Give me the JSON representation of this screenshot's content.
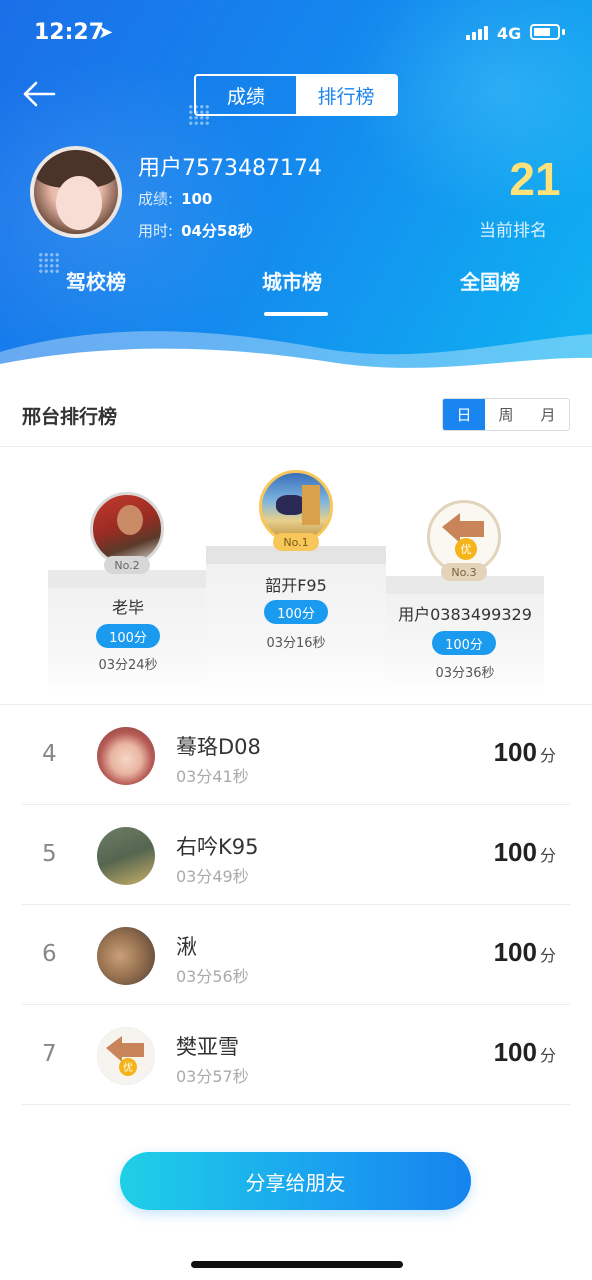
{
  "status_bar": {
    "time": "12:27",
    "network": "4G"
  },
  "segment": {
    "left_label": "成绩",
    "right_label": "排行榜",
    "active": "排行榜"
  },
  "user": {
    "name": "用户7573487174",
    "score_label": "成绩:",
    "score_value": "100",
    "time_label": "用时:",
    "time_value": "04分58秒"
  },
  "current_rank": {
    "value": "21",
    "label": "当前排名"
  },
  "tabs": [
    {
      "label": "驾校榜"
    },
    {
      "label": "城市榜"
    },
    {
      "label": "全国榜"
    }
  ],
  "active_tab": "城市榜",
  "section": {
    "title": "邢台排行榜"
  },
  "period": {
    "options": [
      "日",
      "周",
      "月"
    ],
    "active": "日"
  },
  "podium": [
    {
      "badge": "No.1",
      "name": "韶开F95",
      "score": "100分",
      "time": "03分16秒"
    },
    {
      "badge": "No.2",
      "name": "老毕",
      "score": "100分",
      "time": "03分24秒"
    },
    {
      "badge": "No.3",
      "name": "用户0383499329",
      "score": "100分",
      "time": "03分36秒",
      "avatar_text": "优"
    }
  ],
  "list": [
    {
      "rank": "4",
      "name": "蓦珞D08",
      "time": "03分41秒",
      "score": "100",
      "unit": "分"
    },
    {
      "rank": "5",
      "name": "右吟K95",
      "time": "03分49秒",
      "score": "100",
      "unit": "分"
    },
    {
      "rank": "6",
      "name": "湫",
      "time": "03分56秒",
      "score": "100",
      "unit": "分"
    },
    {
      "rank": "7",
      "name": "樊亚雪",
      "time": "03分57秒",
      "score": "100",
      "unit": "分",
      "avatar_text": "优"
    }
  ],
  "share_button": {
    "label": "分享给朋友"
  },
  "colors": {
    "header_start": "#1b6fe8",
    "header_end": "#0fb4f2",
    "accent": "#1a84f0",
    "rank_yellow": "#ffe27a",
    "badge_gold": "#f7c75a"
  }
}
